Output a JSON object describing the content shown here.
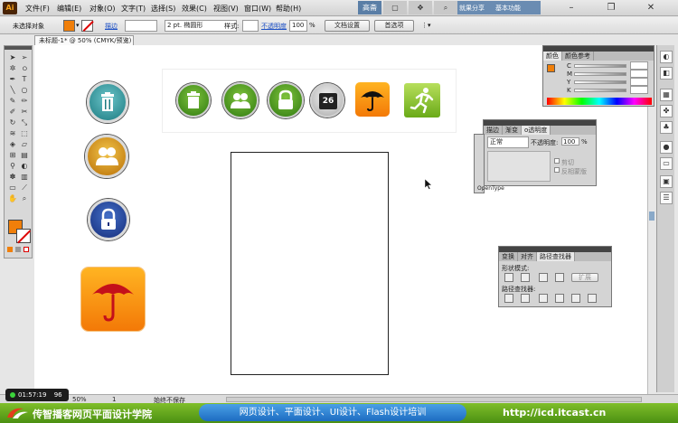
{
  "app": {
    "logo": "Ai"
  },
  "menu": [
    "文件(F)",
    "编辑(E)",
    "对象(O)",
    "文字(T)",
    "选择(S)",
    "效果(C)",
    "视图(V)",
    "窗口(W)",
    "帮助(H)"
  ],
  "menu_right": {
    "btn1": "高斋",
    "essentials": "就果分享",
    "workspace": "基本功能"
  },
  "control_bar": {
    "no_selection": "未选择对象",
    "stroke_label": "描边",
    "brush": "2 pt. 椭圆形",
    "style_label": "样式:",
    "opacity_label": "不透明度",
    "opacity_value": "100",
    "percent": "%",
    "doc_setup": "文档设置",
    "preferences": "首选项"
  },
  "document_tab": {
    "title": "未标题-1* @ 50% (CMYK/预览)",
    "close": "×"
  },
  "color_panel": {
    "tabs": [
      "颜色",
      "颜色参考"
    ],
    "channels": [
      "C",
      "M",
      "Y",
      "K"
    ],
    "percent": "%"
  },
  "transparency_panel": {
    "tabs": [
      "描边",
      "渐变",
      "o透明度"
    ],
    "blend_mode": "正常",
    "opacity_label": "不透明度:",
    "opacity_value": "100",
    "percent": "%",
    "clip": "剪切",
    "invert_mask": "反相蒙版",
    "opentype": "OpenType"
  },
  "pathfinder_panel": {
    "tabs": [
      "变换",
      "对齐",
      "路径查找器"
    ],
    "shape_modes": "形状模式:",
    "expand": "扩展",
    "pathfinders": "路径查找器:"
  },
  "status": {
    "zoom": "50%",
    "page": "1",
    "state": "始终不保存"
  },
  "recorder": {
    "time": "01:57:19",
    "count": "96"
  },
  "banner": {
    "name": "传智播客网页平面设计学院",
    "courses": "网页设计、平面设计、UI设计、Flash设计培训",
    "url": "http://icd.itcast.cn"
  },
  "colors": {
    "accent_orange": "#f07f0a",
    "banner_green": "#5ea31c",
    "banner_blue": "#1d6cc1",
    "icon_green": "#4e9a1e"
  },
  "icons": {
    "canvas_left": [
      "trash-icon",
      "users-icon",
      "lock-icon",
      "umbrella-icon"
    ],
    "strip": [
      "trash-icon",
      "users-icon",
      "lock-icon",
      "calendar-icon",
      "umbrella-icon",
      "runner-icon"
    ],
    "calendar_day": "26"
  }
}
